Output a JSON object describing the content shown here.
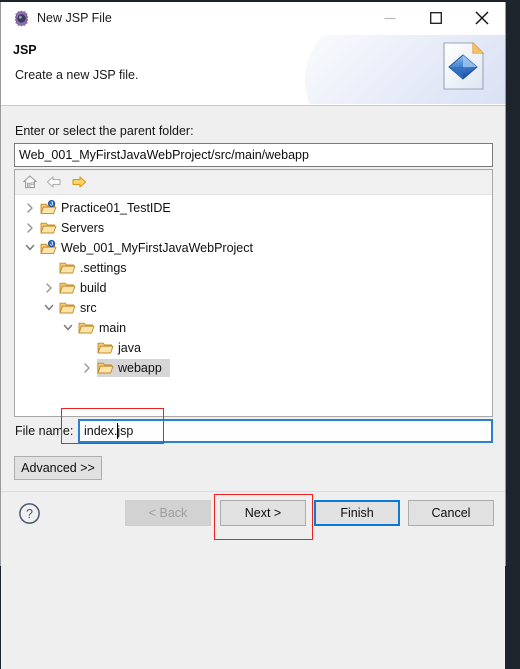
{
  "window": {
    "title": "New JSP File",
    "icon": "eclipse-gear-icon",
    "minimize_label": "Minimize",
    "maximize_label": "Maximize",
    "close_label": "Close"
  },
  "header": {
    "title": "JSP",
    "subtitle": "Create a new JSP file.",
    "banner_icon": "jsp-file-wizard-icon"
  },
  "parent_folder": {
    "label": "Enter or select the parent folder:",
    "value": "Web_001_MyFirstJavaWebProject/src/main/webapp",
    "placeholder": ""
  },
  "tree_toolbar": {
    "home": "home-icon",
    "back": "back-arrow-icon",
    "forward": "forward-arrow-icon"
  },
  "tree": {
    "items": [
      {
        "label": "Practice01_TestIDE",
        "depth": 0,
        "twisty": "collapsed",
        "icon": "java-project-folder-icon",
        "selected": false
      },
      {
        "label": "Servers",
        "depth": 0,
        "twisty": "collapsed",
        "icon": "folder-icon",
        "selected": false
      },
      {
        "label": "Web_001_MyFirstJavaWebProject",
        "depth": 0,
        "twisty": "expanded",
        "icon": "java-project-folder-icon",
        "selected": false
      },
      {
        "label": ".settings",
        "depth": 1,
        "twisty": "none",
        "icon": "folder-icon",
        "selected": false
      },
      {
        "label": "build",
        "depth": 1,
        "twisty": "collapsed",
        "icon": "folder-icon",
        "selected": false
      },
      {
        "label": "src",
        "depth": 1,
        "twisty": "expanded",
        "icon": "folder-icon",
        "selected": false
      },
      {
        "label": "main",
        "depth": 2,
        "twisty": "expanded",
        "icon": "folder-icon",
        "selected": false
      },
      {
        "label": "java",
        "depth": 3,
        "twisty": "none",
        "icon": "folder-icon",
        "selected": false
      },
      {
        "label": "webapp",
        "depth": 3,
        "twisty": "collapsed",
        "icon": "folder-icon",
        "selected": true
      }
    ]
  },
  "file_name": {
    "label": "File name:",
    "value": "index.jsp",
    "placeholder": ""
  },
  "advanced": {
    "label": "Advanced >>"
  },
  "footer": {
    "help": "help-icon",
    "back": "< Back",
    "next": "Next >",
    "finish": "Finish",
    "cancel": "Cancel"
  },
  "annotations": {
    "filename_box": "red-highlight-file-name",
    "next_box": "red-highlight-next-button"
  },
  "colors": {
    "accent_blue": "#0a7bd4",
    "annotation_red": "#ee2020",
    "dialog_bg": "#efefef",
    "folder_orange": "#e8a33d"
  }
}
